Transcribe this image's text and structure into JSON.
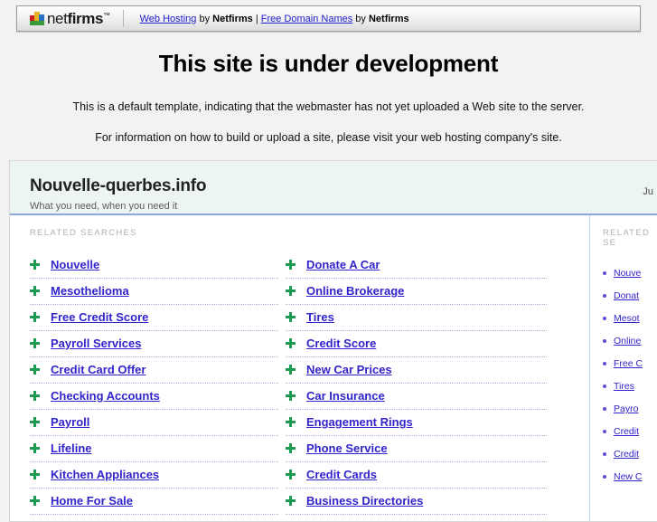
{
  "netfirms_bar": {
    "logo_text_light": "net",
    "logo_text_bold": "firms",
    "logo_tm": "™",
    "link_web_hosting": "Web Hosting",
    "by_1": " by ",
    "brand_1": "Netfirms",
    "divider": " | ",
    "link_free_domains": "Free Domain Names",
    "by_2": " by ",
    "brand_2": "Netfirms"
  },
  "development_notice": {
    "heading": "This site is under development",
    "line1": "This is a default template, indicating that the webmaster has not yet uploaded a Web site to the server.",
    "line2": "For information on how to build or upload a site, please visit your web hosting company's site."
  },
  "parking_panel": {
    "domain": "Nouvelle-querbes.info",
    "tagline": "What you need, when you need it",
    "date": "Ju",
    "section_label_main": "RELATED SEARCHES",
    "section_label_side": "RELATED SE",
    "column1": [
      "Nouvelle",
      "Mesothelioma",
      "Free Credit Score",
      "Payroll Services",
      "Credit Card Offer",
      "Checking Accounts",
      "Payroll",
      "Lifeline",
      "Kitchen Appliances",
      "Home For Sale"
    ],
    "column2": [
      "Donate A Car",
      "Online Brokerage",
      "Tires",
      "Credit Score",
      "New Car Prices",
      "Car Insurance",
      "Engagement Rings",
      "Phone Service",
      "Credit Cards",
      "Business Directories"
    ],
    "sidebar": [
      "Nouve",
      "Donat",
      "Mesot",
      "Online",
      "Free C",
      "Tires",
      "Payro",
      "Credit",
      "Credit",
      "New C"
    ]
  },
  "colors": {
    "link": "#3224cb",
    "bullet_green": "#1e9b52",
    "bullet_purple": "#5a4fd0",
    "panel_header_bg": "#edf4f4",
    "panel_header_rule": "#8ea6de",
    "page_bg": "#f2f2f2"
  }
}
